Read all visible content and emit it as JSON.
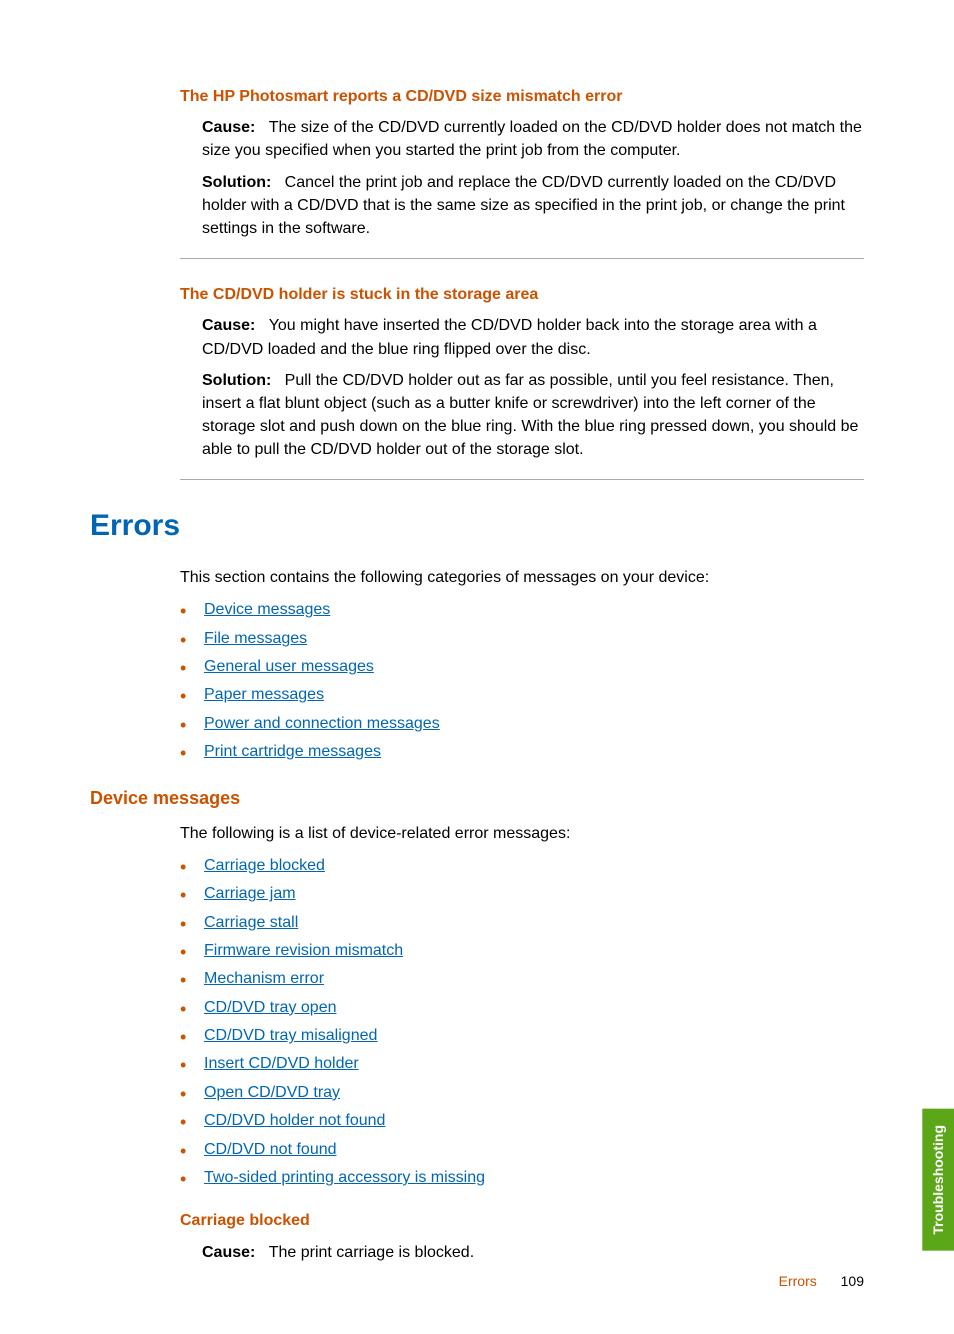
{
  "section1": {
    "heading": "The HP Photosmart reports a CD/DVD size mismatch error",
    "cause_label": "Cause:",
    "cause_text": "The size of the CD/DVD currently loaded on the CD/DVD holder does not match the size you specified when you started the print job from the computer.",
    "solution_label": "Solution:",
    "solution_text": "Cancel the print job and replace the CD/DVD currently loaded on the CD/DVD holder with a CD/DVD that is the same size as specified in the print job, or change the print settings in the software."
  },
  "section2": {
    "heading": "The CD/DVD holder is stuck in the storage area",
    "cause_label": "Cause:",
    "cause_text": "You might have inserted the CD/DVD holder back into the storage area with a CD/DVD loaded and the blue ring flipped over the disc.",
    "solution_label": "Solution:",
    "solution_text": "Pull the CD/DVD holder out as far as possible, until you feel resistance. Then, insert a flat blunt object (such as a butter knife or screwdriver) into the left corner of the storage slot and push down on the blue ring. With the blue ring pressed down, you should be able to pull the CD/DVD holder out of the storage slot."
  },
  "errors": {
    "heading": "Errors",
    "intro": "This section contains the following categories of messages on your device:",
    "links": [
      "Device messages",
      "File messages",
      "General user messages",
      "Paper messages",
      "Power and connection messages",
      "Print cartridge messages"
    ]
  },
  "device_messages": {
    "heading": "Device messages",
    "intro": "The following is a list of device-related error messages:",
    "links": [
      "Carriage blocked",
      "Carriage jam",
      "Carriage stall",
      "Firmware revision mismatch",
      "Mechanism error",
      "CD/DVD tray open",
      "CD/DVD tray misaligned",
      "Insert CD/DVD holder",
      "Open CD/DVD tray",
      "CD/DVD holder not found",
      "CD/DVD not found",
      "Two-sided printing accessory is missing"
    ]
  },
  "carriage_blocked": {
    "heading": "Carriage blocked",
    "cause_label": "Cause:",
    "cause_text": "The print carriage is blocked."
  },
  "side_tab": "Troubleshooting",
  "footer": {
    "label": "Errors",
    "page": "109"
  }
}
